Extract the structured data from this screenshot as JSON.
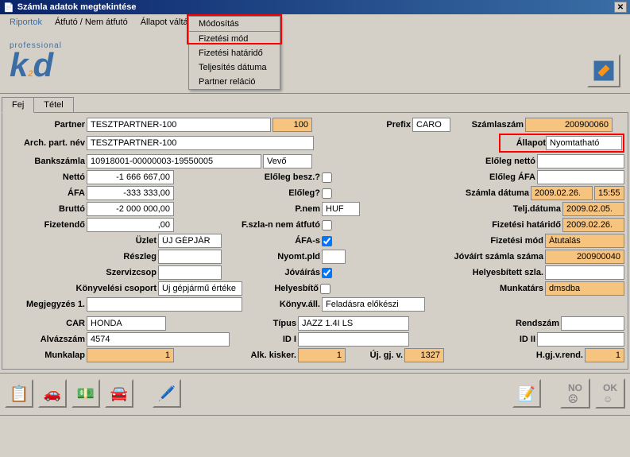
{
  "title": "Számla adatok megtekintése",
  "menu": {
    "riportok": "Riportok",
    "atfuto": "Átfutó / Nem átfutó",
    "allapot": "Állapot váltás",
    "modositas": "Módosítás"
  },
  "dropdown": {
    "fizetesi_mod": "Fizetési mód",
    "fizetesi_hatarido": "Fizetési határidő",
    "teljesites_datuma": "Teljesítés dátuma",
    "partner_relacio": "Partner reláció"
  },
  "logo": {
    "prof": "professional",
    "name": "k2d"
  },
  "tabs": {
    "fej": "Fej",
    "tetel": "Tétel"
  },
  "labels": {
    "partner": "Partner",
    "arch_part_nev": "Arch. part. név",
    "bankszamla": "Bankszámla",
    "netto": "Nettó",
    "afa": "ÁFA",
    "brutto": "Bruttó",
    "fizetendo": "Fizetendő",
    "uzlet": "Üzlet",
    "reszleg": "Részleg",
    "szervizcsop": "Szervizcsop",
    "konyvelesi_csoport": "Könyvelési csoport",
    "megjegyzes1": "Megjegyzés 1.",
    "car": "CAR",
    "alvazszam": "Alvázszám",
    "munkalap": "Munkalap",
    "prefix": "Prefix",
    "szamlaszam": "Számlaszám",
    "allapot": "Állapot",
    "eloleg_netto": "Előleg nettó",
    "eloleg_afa": "Előleg ÁFA",
    "szamla_datuma": "Számla dátuma",
    "telj_datuma": "Telj.dátuma",
    "fizetesi_hatarido": "Fizetési határidő",
    "fizetesi_mod": "Fizetési mód",
    "jovair_szamla_szama": "Jóváírt számla száma",
    "helyesbitett_szla": "Helyesbített szla.",
    "munkatars": "Munkatárs",
    "eloleg_besz": "Előleg besz.?",
    "eloleg": "Előleg?",
    "pnem": "P.nem",
    "fszla_nem_atfuto": "F.szla-n nem átfutó",
    "afa_s": "ÁFA-s",
    "nyomt_pld": "Nyomt.pld",
    "jovairas": "Jóváírás",
    "helyesbito": "Helyesbítő",
    "konyv_all": "Könyv.áll.",
    "tipus": "Típus",
    "rendszam": "Rendszám",
    "id1": "ID I",
    "id2": "ID II",
    "alk_kisker": "Alk. kisker.",
    "uj_gj_v": "Új. gj. v.",
    "hgjvrend": "H.gj.v.rend."
  },
  "values": {
    "partner": "TESZTPARTNER-100",
    "partner_code": "100",
    "arch_part_nev": "TESZTPARTNER-100",
    "bankszamla": "10918001-00000003-19550005",
    "bank_type": "Vevő",
    "netto": "-1 666 667,00",
    "afa": "-333 333,00",
    "brutto": "-2 000 000,00",
    "fizetendo": ",00",
    "uzlet": "ÚJ GÉPJÁR",
    "konyvelesi_csoport": "Új gépjármű értéke",
    "car": "HONDA",
    "alvazszam": "4574",
    "munkalap": "1",
    "prefix": "CARO",
    "szamlaszam": "200900060",
    "allapot": "Nyomtatható",
    "szamla_datuma": "2009.02.26.",
    "szamla_time": "15:55",
    "telj_datuma": "2009.02.05.",
    "fizetesi_hatarido": "2009.02.26.",
    "fizetesi_mod": "Átutalás",
    "jovair_szamla_szama": "200900040",
    "munkatars": "dmsdba",
    "pnem": "HUF",
    "konyv_all": "Feladásra előkészi",
    "tipus": "JAZZ 1.4I LS",
    "alk_kisker": "1",
    "uj_gj_v": "1327",
    "hgjvrend": "1"
  }
}
